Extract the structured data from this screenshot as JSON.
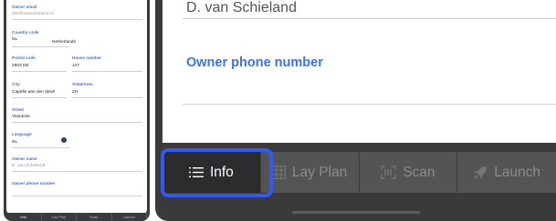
{
  "phone": {
    "fields": [
      {
        "label": "Owner email",
        "value": "dirk@vanschieland.nl"
      },
      {
        "label": "Country code",
        "value": "NL",
        "value2": "Netherlands"
      },
      {
        "label": "Postal code",
        "value": "2903 DE",
        "label2": "House number",
        "value2": "147"
      },
      {
        "label": "City",
        "value": "Capelle aan den Ijssel",
        "label2": "State/Area",
        "value2": "ZH"
      },
      {
        "label": "Street",
        "value": "Vlasdonk"
      },
      {
        "label": "Language",
        "value": "NL"
      },
      {
        "label": "Owner name",
        "value": "D. van Schieland"
      },
      {
        "label": "Owner phone number",
        "value": ""
      }
    ],
    "tabs": [
      "Info",
      "Lay Plan",
      "Scan",
      "Launch"
    ]
  },
  "main": {
    "owner_name_value": "D. van Schieland",
    "owner_phone_label": "Owner phone number"
  },
  "tabbar": {
    "tabs": [
      {
        "label": "Info",
        "icon": "list-icon",
        "active": true
      },
      {
        "label": "Lay Plan",
        "icon": "grid-icon",
        "active": false
      },
      {
        "label": "Scan",
        "icon": "scan-icon",
        "active": false
      },
      {
        "label": "Launch",
        "icon": "rocket-icon",
        "active": false
      }
    ]
  },
  "colors": {
    "accent": "#3a72f0",
    "highlight": "#2f5bf0",
    "tabbar": "#545457",
    "active_tab": "#2c2c2e"
  }
}
